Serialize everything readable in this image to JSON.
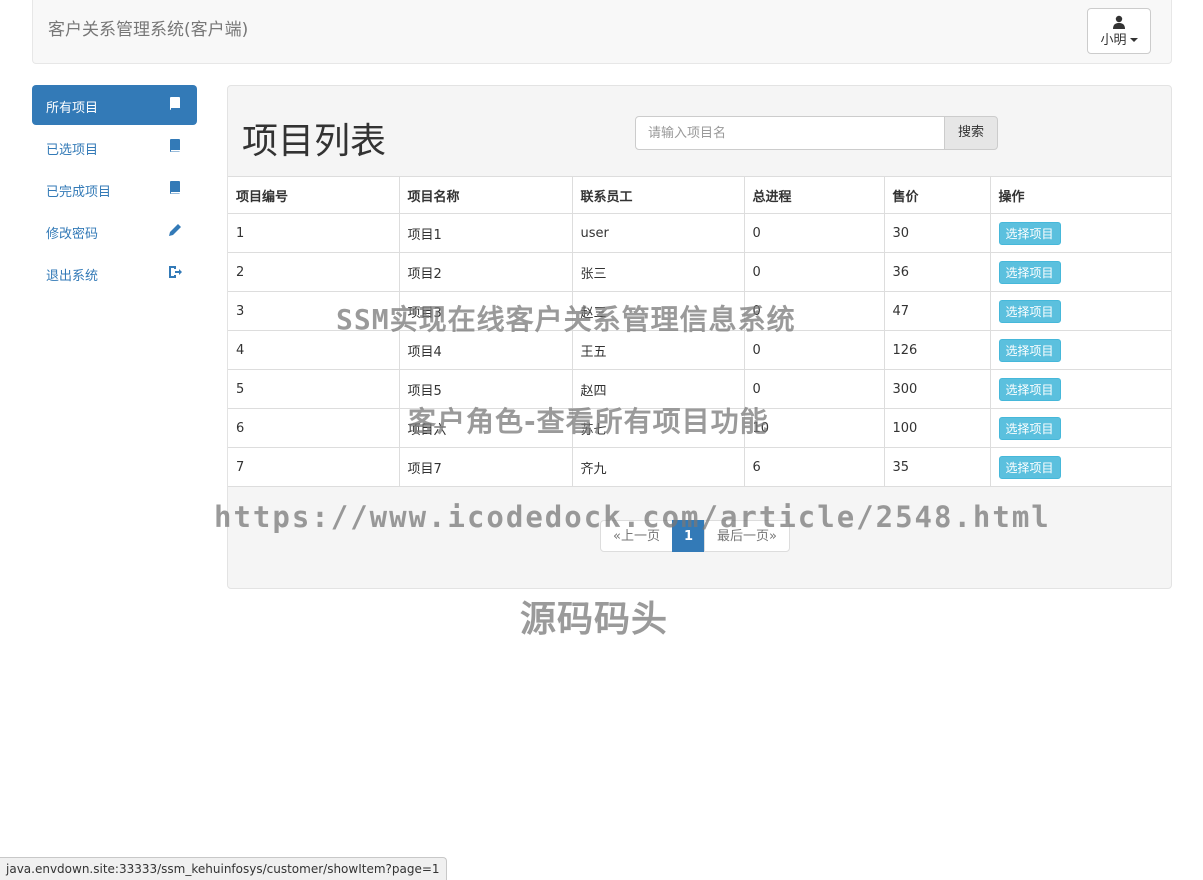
{
  "navbar": {
    "brand": "客户关系管理系统(客户端)",
    "user_name": "小明"
  },
  "sidebar": {
    "items": [
      {
        "label": "所有项目",
        "icon": "book-icon",
        "active": true
      },
      {
        "label": "已选项目",
        "icon": "book-icon",
        "active": false
      },
      {
        "label": "已完成项目",
        "icon": "book-icon",
        "active": false
      },
      {
        "label": "修改密码",
        "icon": "pencil-icon",
        "active": false
      },
      {
        "label": "退出系统",
        "icon": "logout-icon",
        "active": false
      }
    ]
  },
  "main": {
    "title": "项目列表",
    "search": {
      "placeholder": "请输入项目名",
      "button_label": "搜索"
    },
    "table": {
      "headers": [
        "项目编号",
        "项目名称",
        "联系员工",
        "总进程",
        "售价",
        "操作"
      ],
      "rows": [
        {
          "id": "1",
          "name": "项目1",
          "employee": "user",
          "progress": "0",
          "price": "30",
          "action": "选择项目"
        },
        {
          "id": "2",
          "name": "项目2",
          "employee": "张三",
          "progress": "0",
          "price": "36",
          "action": "选择项目"
        },
        {
          "id": "3",
          "name": "项目3",
          "employee": "赵三",
          "progress": "0",
          "price": "47",
          "action": "选择项目"
        },
        {
          "id": "4",
          "name": "项目4",
          "employee": "王五",
          "progress": "0",
          "price": "126",
          "action": "选择项目"
        },
        {
          "id": "5",
          "name": "项目5",
          "employee": "赵四",
          "progress": "0",
          "price": "300",
          "action": "选择项目"
        },
        {
          "id": "6",
          "name": "项目六",
          "employee": "苏七",
          "progress": "10",
          "price": "100",
          "action": "选择项目"
        },
        {
          "id": "7",
          "name": "项目7",
          "employee": "齐九",
          "progress": "6",
          "price": "35",
          "action": "选择项目"
        }
      ]
    },
    "pagination": {
      "prev": "«上一页",
      "current": "1",
      "last": "最后一页»"
    }
  },
  "watermarks": {
    "line1": "SSM实现在线客户关系管理信息系统",
    "line2": "客户角色-查看所有项目功能",
    "line3": "https://www.icodedock.com/article/2548.html",
    "line4": "源码码头"
  },
  "statusbar": {
    "url": "java.envdown.site:33333/ssm_kehuinfosys/customer/showItem?page=1"
  },
  "colors": {
    "primary": "#337ab7",
    "info": "#5bc0de"
  }
}
